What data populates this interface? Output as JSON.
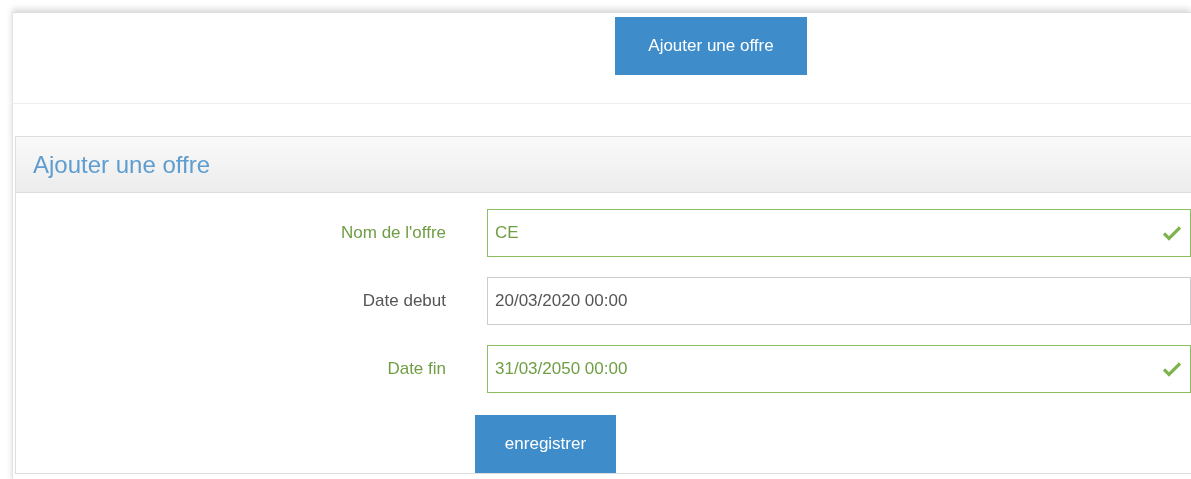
{
  "toolbar": {
    "add_button": "Ajouter une offre"
  },
  "panel": {
    "title": "Ajouter une offre",
    "fields": [
      {
        "label": "Nom de l'offre",
        "value": "CE",
        "valid": true
      },
      {
        "label": "Date debut",
        "value": "20/03/2020 00:00",
        "valid": false
      },
      {
        "label": "Date fin",
        "value": "31/03/2050 00:00",
        "valid": true
      }
    ],
    "submit_button": "enregistrer"
  }
}
